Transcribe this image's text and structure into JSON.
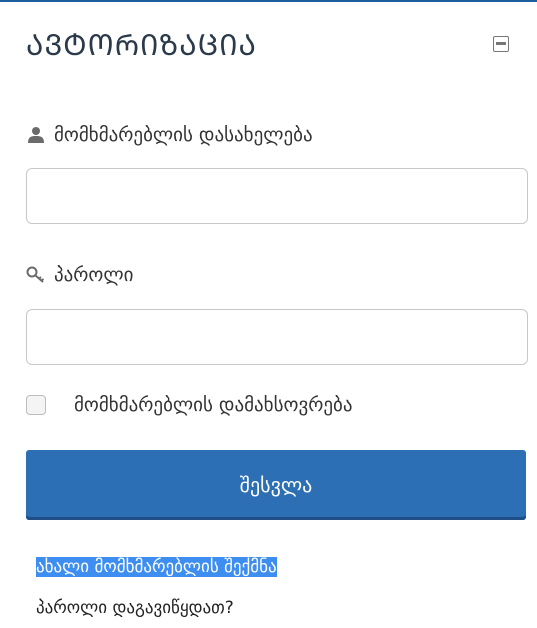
{
  "panel": {
    "title": "ᲐᲕᲢᲝᲠᲘᲖᲐᲪᲘᲐ",
    "collapse_icon": "minus-square-icon",
    "accent_color": "#2c6fb5"
  },
  "login_form": {
    "username_label": "მომხმარებლის დასახელება",
    "username_icon": "user-icon",
    "username_value": "",
    "password_label": "პაროლი",
    "password_icon": "key-icon",
    "password_value": "",
    "remember_label": "მომხმარებლის დამახსოვრება",
    "remember_checked": false,
    "submit_label": "შესვლა"
  },
  "links": {
    "create_account": "ახალი მომხმარებლის შექმნა",
    "forgot_password": "პაროლი დაგავიწყდათ?"
  }
}
